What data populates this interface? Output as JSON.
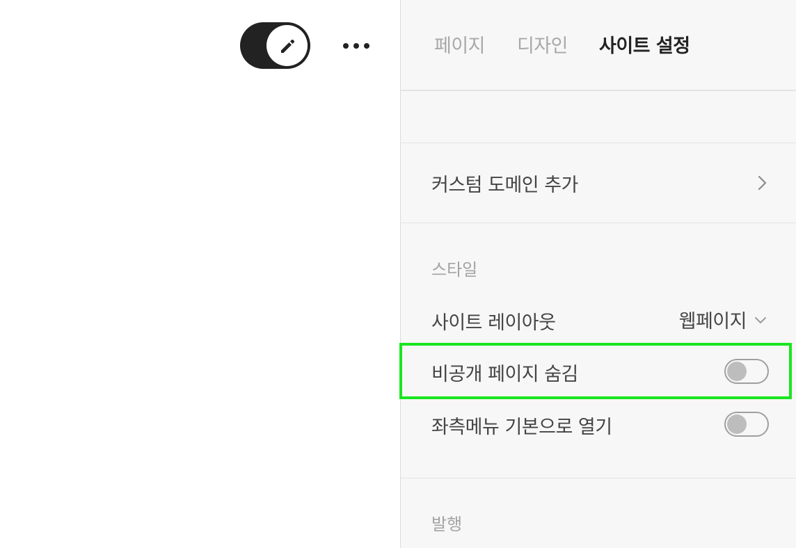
{
  "tabs": [
    {
      "label": "페이지",
      "active": false
    },
    {
      "label": "디자인",
      "active": false
    },
    {
      "label": "사이트 설정",
      "active": true
    }
  ],
  "custom_domain": {
    "label": "커스텀 도메인 추가"
  },
  "style_section": {
    "title": "스타일",
    "site_layout": {
      "label": "사이트 레이아웃",
      "value": "웹페이지"
    },
    "hide_private_pages": {
      "label": "비공개 페이지 숨김",
      "on": false
    },
    "open_left_menu": {
      "label": "좌측메뉴 기본으로 열기",
      "on": false
    }
  },
  "publish_section": {
    "title": "발행"
  },
  "colors": {
    "highlight": "#19e61e",
    "toggle_dark": "#222222",
    "panel_bg": "#f7f7f7"
  },
  "icons": {
    "edit": "pencil-icon",
    "more": "more-horizontal-icon",
    "chevron": "chevron-right-icon",
    "dropdown": "chevron-down-icon"
  }
}
